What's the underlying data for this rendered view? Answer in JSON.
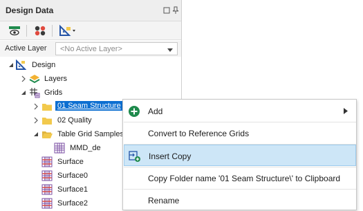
{
  "panel": {
    "title": "Design Data",
    "active_layer_label": "Active Layer",
    "active_layer_value": "<No Active Layer>"
  },
  "tree": {
    "root": "Design",
    "layers": "Layers",
    "grids": "Grids",
    "seam_structure": "01 Seam Structure",
    "quality": "02 Quality",
    "table_grid_samples": "Table Grid Samples",
    "mmd_de": "MMD_de",
    "surface": "Surface",
    "surface0": "Surface0",
    "surface1": "Surface1",
    "surface2": "Surface2"
  },
  "context_menu": {
    "add": "Add",
    "convert": "Convert to Reference Grids",
    "insert_copy": "Insert Copy",
    "copy_folder_name": "Copy Folder name '01 Seam Structure\\' to Clipboard",
    "rename": "Rename"
  },
  "colors": {
    "selection": "#0d6fd1",
    "menu_highlight": "#cde6f7",
    "folder": "#f2c94c",
    "grid_icon": "#7b4fa3"
  }
}
